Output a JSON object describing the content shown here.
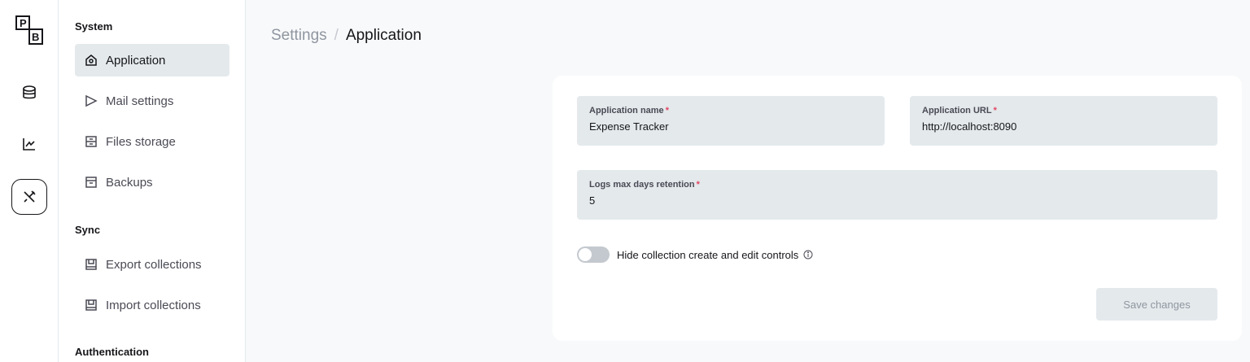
{
  "rail": {
    "logo_letters": [
      "P",
      "B"
    ]
  },
  "sidebar": {
    "sections": [
      {
        "title": "System"
      },
      {
        "title": "Sync"
      },
      {
        "title": "Authentication"
      }
    ],
    "items": [
      {
        "label": "Application",
        "icon": "home-icon",
        "active": true
      },
      {
        "label": "Mail settings",
        "icon": "send-icon"
      },
      {
        "label": "Files storage",
        "icon": "storage-icon"
      },
      {
        "label": "Backups",
        "icon": "archive-icon"
      },
      {
        "label": "Export collections",
        "icon": "export-icon"
      },
      {
        "label": "Import collections",
        "icon": "import-icon"
      }
    ]
  },
  "breadcrumb": {
    "parent": "Settings",
    "separator": "/",
    "current": "Application"
  },
  "form": {
    "app_name": {
      "label": "Application name",
      "required_mark": "*",
      "value": "Expense Tracker"
    },
    "app_url": {
      "label": "Application URL",
      "required_mark": "*",
      "value": "http://localhost:8090"
    },
    "logs_retention": {
      "label": "Logs max days retention",
      "required_mark": "*",
      "value": "5"
    },
    "hide_controls": {
      "label": "Hide collection create and edit controls",
      "checked": false
    },
    "save_label": "Save changes"
  },
  "colors": {
    "accent_text": "#16161a",
    "muted": "#8f96a0",
    "field_bg": "#e4e9ec",
    "required": "#e34562"
  }
}
